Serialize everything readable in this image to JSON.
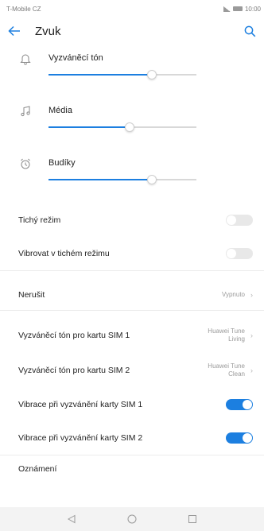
{
  "statusbar": {
    "carrier": "T-Mobile CZ",
    "time": "10:00"
  },
  "appbar": {
    "title": "Zvuk"
  },
  "volume": [
    {
      "label": "Vyzváněcí tón",
      "icon": "bell-icon",
      "level": 0.7
    },
    {
      "label": "Média",
      "icon": "music-note-icon",
      "level": 0.55
    },
    {
      "label": "Budíky",
      "icon": "alarm-clock-icon",
      "level": 0.7
    }
  ],
  "toggles_silent": [
    {
      "label": "Tichý režim",
      "on": false
    },
    {
      "label": "Vibrovat v tichém režimu",
      "on": false
    }
  ],
  "dnd": {
    "label": "Nerušit",
    "value": "Vypnuto"
  },
  "sim_ringtones": [
    {
      "label": "Vyzváněcí tón pro kartu SIM 1",
      "value_line1": "Huawei Tune",
      "value_line2": "Living"
    },
    {
      "label": "Vyzváněcí tón pro kartu SIM 2",
      "value_line1": "Huawei Tune",
      "value_line2": "Clean"
    }
  ],
  "sim_vibrate": [
    {
      "label": "Vibrace při vyzvánění karty SIM 1",
      "on": true
    },
    {
      "label": "Vibrace při vyzvánění karty SIM 2",
      "on": true
    }
  ],
  "notifications": {
    "label": "Oznámení"
  },
  "colors": {
    "accent": "#1c7fe0",
    "toggle_off": "#e8e8e8"
  }
}
